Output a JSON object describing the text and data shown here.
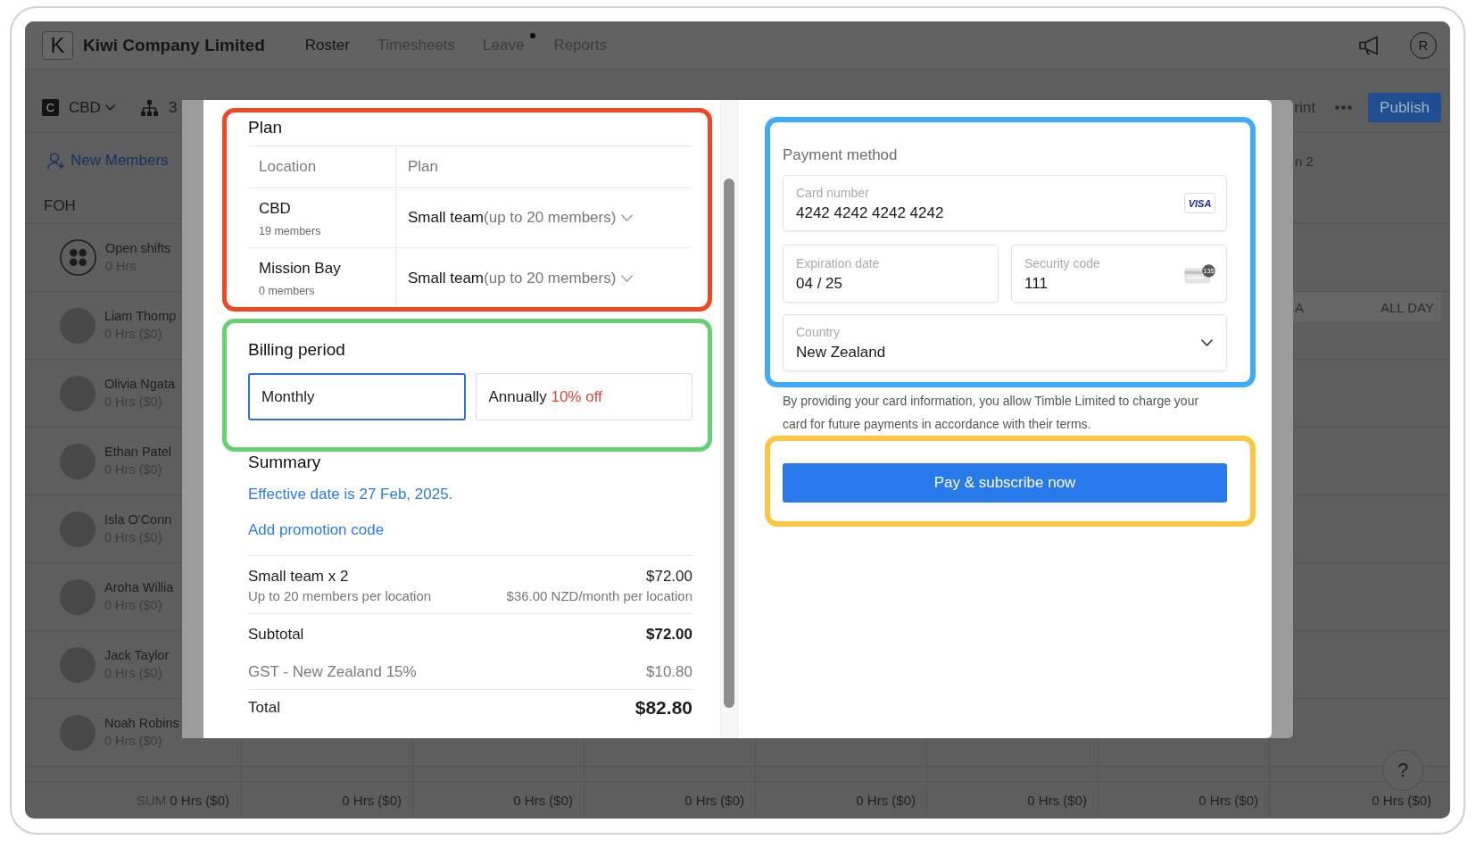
{
  "app": {
    "logo_letter": "K",
    "company": "Kiwi Company Limited",
    "nav": [
      {
        "label": "Roster",
        "selected": true,
        "badge_dot": false
      },
      {
        "label": "Timesheets",
        "selected": false,
        "badge_dot": false
      },
      {
        "label": "Leave",
        "selected": false,
        "badge_dot": true
      },
      {
        "label": "Reports",
        "selected": false,
        "badge_dot": false
      }
    ],
    "account_initial": "R"
  },
  "toolbar": {
    "location_initial": "C",
    "location": "CBD",
    "team_count": "3",
    "print_cut": "rint",
    "publish": "Publish"
  },
  "filter_row": {
    "new_members": "New Members",
    "day_header_cut": "n 2"
  },
  "roster": {
    "group": "FOH",
    "rows": [
      {
        "kind": "open",
        "name": "Open shifts",
        "hours": "0 Hrs"
      },
      {
        "kind": "member",
        "name": "Liam Thomp",
        "hours": "0 Hrs ($0)",
        "all_day_entry": {
          "text_cut": "A",
          "label": "ALL DAY"
        }
      },
      {
        "kind": "member",
        "name": "Olivia Ngata",
        "hours": "0 Hrs ($0)"
      },
      {
        "kind": "member",
        "name": "Ethan Patel",
        "hours": "0 Hrs ($0)"
      },
      {
        "kind": "member",
        "name": "Isla O'Conn",
        "hours": "0 Hrs ($0)"
      },
      {
        "kind": "member",
        "name": "Aroha Willia",
        "hours": "0 Hrs ($0)"
      },
      {
        "kind": "member",
        "name": "Jack Taylor",
        "hours": "0 Hrs ($0)"
      },
      {
        "kind": "member",
        "name": "Noah Robins",
        "hours": "0 Hrs ($0)"
      }
    ]
  },
  "totals": {
    "label": "SUM",
    "cells": [
      "0 Hrs ($0)",
      "0 Hrs ($0)",
      "0 Hrs ($0)",
      "0 Hrs ($0)",
      "0 Hrs ($0)",
      "0 Hrs ($0)",
      "0 Hrs ($0)",
      "0 Hrs ($0)"
    ]
  },
  "help_button": "?",
  "dialog": {
    "plan": {
      "highlight": {
        "color": "#ee4823"
      },
      "title": "Plan",
      "columns": [
        "Location",
        "Plan"
      ],
      "rows": [
        {
          "location": "CBD",
          "members": "19 members",
          "plan": "Small team",
          "plan_note": "(up to 20 members)"
        },
        {
          "location": "Mission Bay",
          "members": "0 members",
          "plan": "Small team",
          "plan_note": "(up to 20 members)"
        }
      ]
    },
    "billing_period": {
      "highlight": {
        "color": "#63d174"
      },
      "title": "Billing period",
      "options": [
        {
          "label": "Monthly",
          "selected": true
        },
        {
          "label": "Annually",
          "discount": "10% off",
          "selected": false
        }
      ]
    },
    "summary": {
      "title": "Summary",
      "effective_date": "Effective date is 27 Feb, 2025.",
      "promo_link": "Add promotion code",
      "line_items": [
        {
          "label": "Small team x 2",
          "amount": "$72.00",
          "detail": "Up to 20 members per location",
          "detail_amount": "$36.00 NZD/month per location"
        }
      ],
      "subtotal": {
        "label": "Subtotal",
        "amount": "$72.00"
      },
      "tax": {
        "label": "GST - New Zealand 15%",
        "amount": "$10.80"
      },
      "total": {
        "label": "Total",
        "amount": "$82.80"
      }
    },
    "payment_method": {
      "highlight": {
        "color": "#40abfc"
      },
      "title": "Payment method",
      "card_number": {
        "label": "Card number",
        "value": "4242 4242 4242 4242",
        "brand": "VISA"
      },
      "expiration": {
        "label": "Expiration date",
        "value": "04 / 25"
      },
      "security_code": {
        "label": "Security code",
        "value": "111",
        "hint_digits": "135"
      },
      "country": {
        "label": "Country",
        "value": "New Zealand"
      }
    },
    "disclaimer": "By providing your card information, you allow Timble Limited to charge your card for future payments in accordance with their terms.",
    "submit": {
      "highlight": {
        "color": "#fdc640"
      },
      "label": "Pay & subscribe now"
    }
  }
}
